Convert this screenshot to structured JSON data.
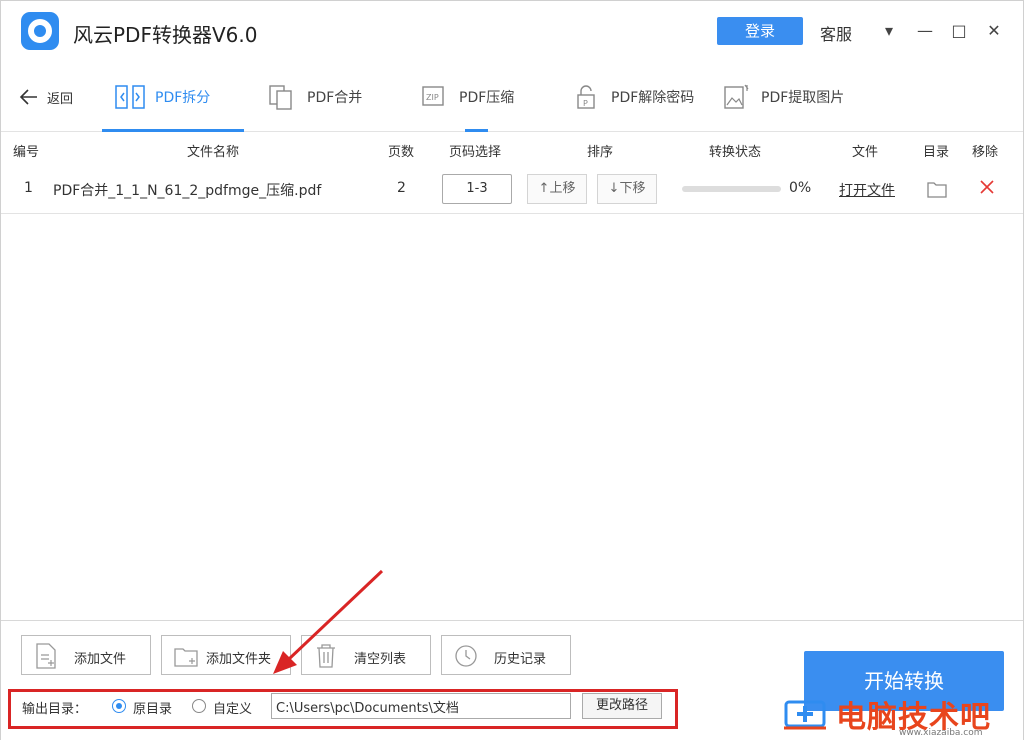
{
  "app": {
    "title": "风云PDF转换器V6.0",
    "login": "登录",
    "service": "客服"
  },
  "window_controls": {
    "menu": "▾",
    "minimize": "—",
    "maximize": "□",
    "close": "✕"
  },
  "toolbar": {
    "back": "返回",
    "tabs": [
      {
        "label": "PDF拆分",
        "icon": "split-icon",
        "active": true
      },
      {
        "label": "PDF合并",
        "icon": "merge-icon"
      },
      {
        "label": "PDF压缩",
        "icon": "zip-icon"
      },
      {
        "label": "PDF解除密码",
        "icon": "unlock-icon"
      },
      {
        "label": "PDF提取图片",
        "icon": "image-icon"
      }
    ]
  },
  "table": {
    "headers": [
      "编号",
      "文件名称",
      "页数",
      "页码选择",
      "排序",
      "转换状态",
      "文件",
      "目录",
      "移除"
    ],
    "rows": [
      {
        "index": "1",
        "name": "PDF合并_1_1_N_61_2_pdfmge_压缩.pdf",
        "pages": "2",
        "page_range": "1-3",
        "up": "↑上移",
        "down": "↓下移",
        "progress_percent": 0,
        "progress_text": "0%",
        "open": "打开文件"
      }
    ]
  },
  "actions": {
    "add_file": "添加文件",
    "add_folder": "添加文件夹",
    "clear_list": "清空列表",
    "history": "历史记录",
    "start": "开始转换"
  },
  "output": {
    "label": "输出目录：",
    "option_original": "原目录",
    "option_custom": "自定义",
    "path": "C:\\Users\\pc\\Documents\\文档",
    "change_path": "更改路径",
    "selected": "original"
  },
  "watermark": {
    "text": "电脑技术吧",
    "url": "www.xiazaiba.com"
  },
  "colors": {
    "accent": "#2f8cf0",
    "highlight": "#d92525",
    "watermark": "#e8451d"
  }
}
